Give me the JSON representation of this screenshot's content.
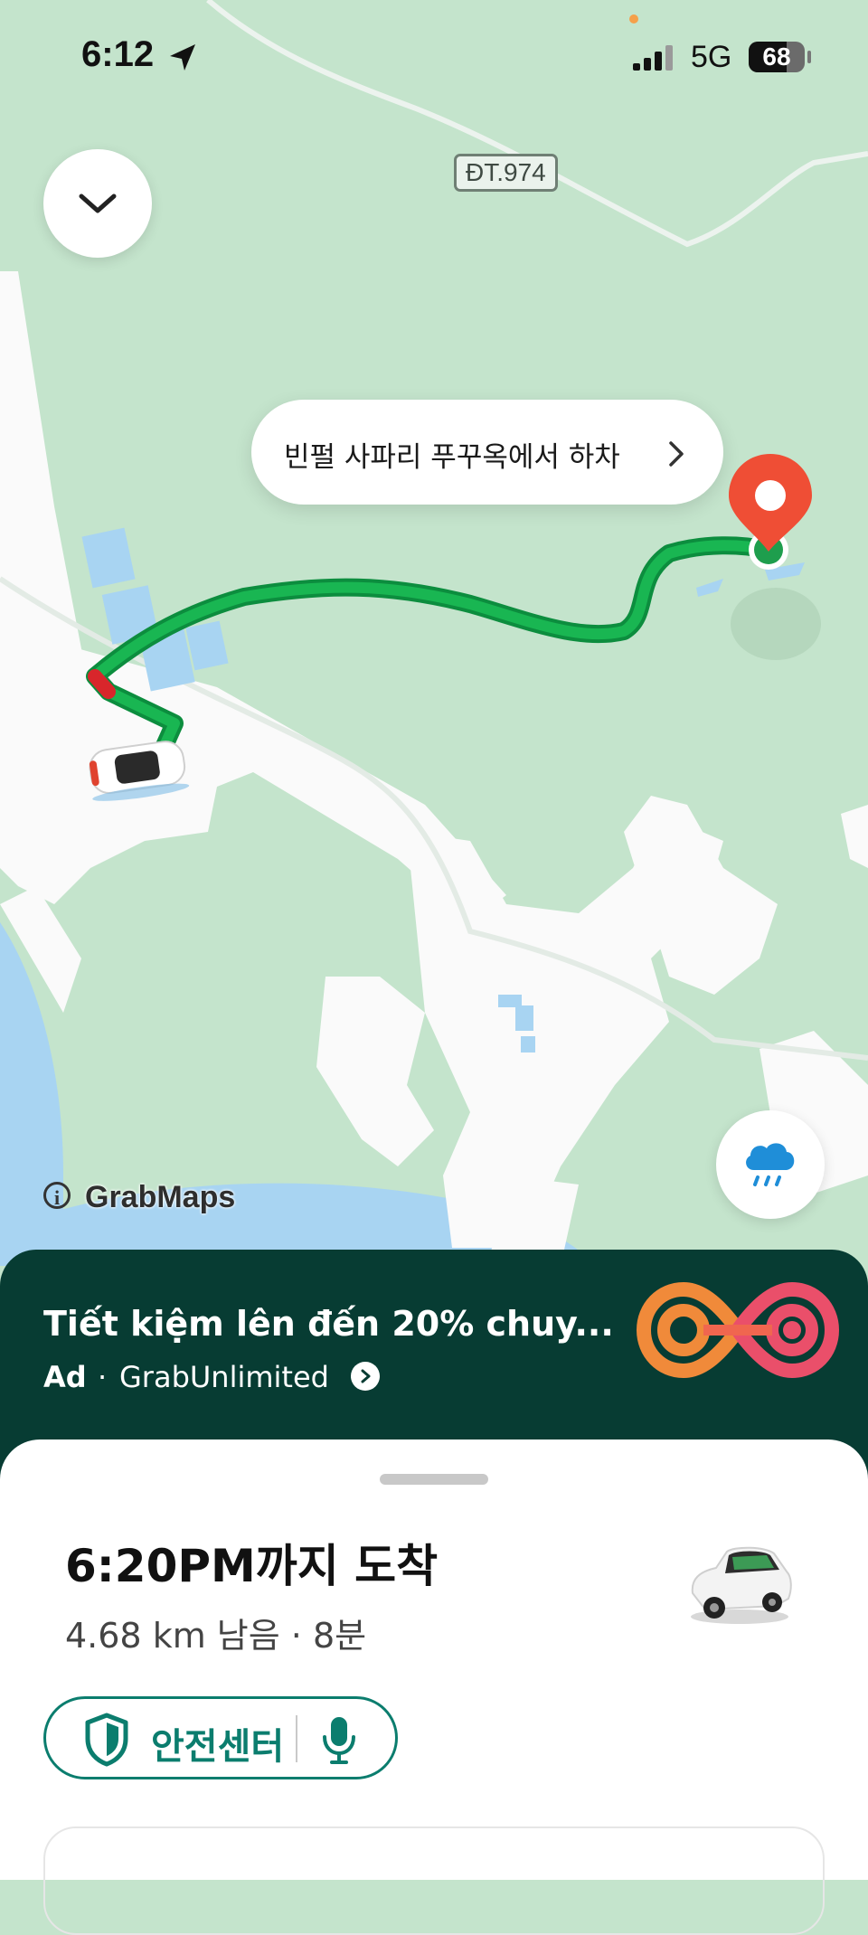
{
  "status_bar": {
    "time": "6:12",
    "network": "5G",
    "battery": "68",
    "battery_level": 0.68
  },
  "map": {
    "road_label": "ĐT.974",
    "destination_label": "빈펄 사파리 푸꾸옥에서 하차",
    "attribution_info": "i",
    "attribution": "GrabMaps",
    "colors": {
      "land": "#c4e4cc",
      "road": "#fafafa",
      "water": "#a8d4f2",
      "route": "#0fa24a",
      "destination_pin": "#ef4e35"
    }
  },
  "icons": {
    "collapse": "chevron-down-icon",
    "location": "location-arrow-icon",
    "weather": "rain-cloud-icon",
    "destination": "map-pin-icon",
    "vehicle": "car-icon",
    "safety": "shield-icon",
    "mic": "microphone-icon"
  },
  "ad": {
    "title": "Tiết kiệm lên đến 20% chuy...",
    "tag": "Ad",
    "separator": "·",
    "brand": "GrabUnlimited",
    "colors": {
      "background": "#073c33",
      "logo_orange": "#f08a3a",
      "logo_pink": "#ea4f6a"
    }
  },
  "trip": {
    "eta": "6:20PM까지 도착",
    "remaining": "4.68 km 남음 · 8분"
  },
  "safety": {
    "label": "안전센터",
    "accent": "#0b7d6e"
  }
}
